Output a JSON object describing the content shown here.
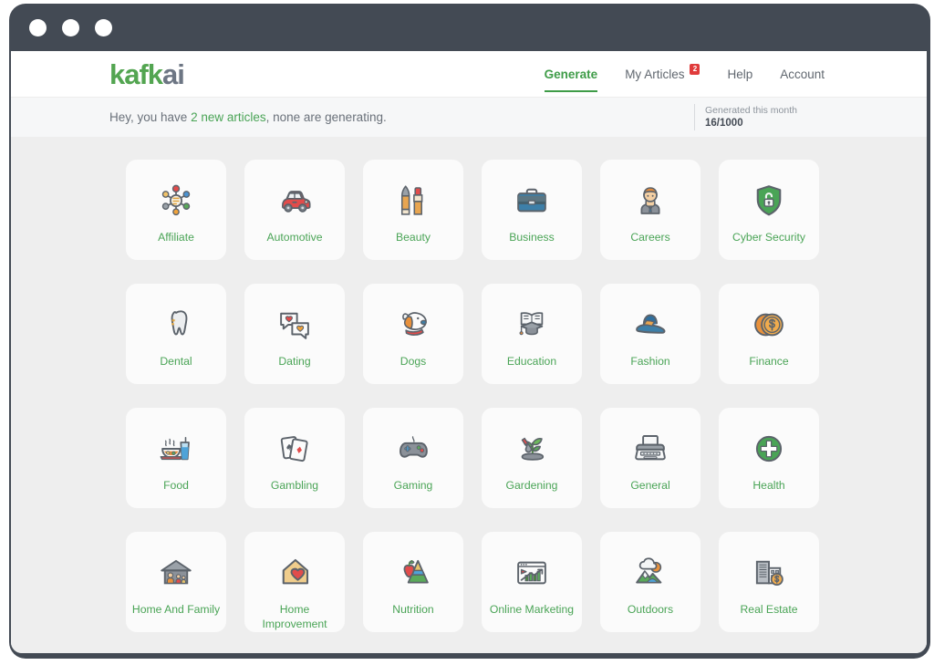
{
  "window": {
    "traffic_lights": [
      "close-dot",
      "minimize-dot",
      "maximize-dot"
    ]
  },
  "header": {
    "logo_green": "kafk",
    "logo_gray": "ai",
    "nav": [
      {
        "label": "Generate",
        "active": true,
        "badge": null,
        "name": "nav-generate"
      },
      {
        "label": "My Articles",
        "active": false,
        "badge": "2",
        "name": "nav-my-articles"
      },
      {
        "label": "Help",
        "active": false,
        "badge": null,
        "name": "nav-help"
      },
      {
        "label": "Account",
        "active": false,
        "badge": null,
        "name": "nav-account"
      }
    ]
  },
  "notice": {
    "prefix": "Hey, you have ",
    "highlight": "2 new articles",
    "suffix": ", none are generating.",
    "quota_label": "Generated this month",
    "quota_value": "16/1000"
  },
  "colors": {
    "brand_green": "#4aa456",
    "active_green": "#3f9c48",
    "badge_red": "#e03b3b",
    "chrome_dark": "#434A54",
    "page_bg": "#eeeeee",
    "card_bg": "#fbfbfb"
  },
  "categories": [
    {
      "label": "Affiliate",
      "icon": "affiliate-network-icon"
    },
    {
      "label": "Automotive",
      "icon": "car-icon"
    },
    {
      "label": "Beauty",
      "icon": "makeup-brush-lipstick-icon"
    },
    {
      "label": "Business",
      "icon": "briefcase-icon"
    },
    {
      "label": "Careers",
      "icon": "businessman-icon"
    },
    {
      "label": "Cyber Security",
      "icon": "shield-lock-icon"
    },
    {
      "label": "Dental",
      "icon": "tooth-icon"
    },
    {
      "label": "Dating",
      "icon": "chat-hearts-icon"
    },
    {
      "label": "Dogs",
      "icon": "dog-head-icon"
    },
    {
      "label": "Education",
      "icon": "book-graduation-cap-icon"
    },
    {
      "label": "Fashion",
      "icon": "sun-hat-icon"
    },
    {
      "label": "Finance",
      "icon": "dollar-coins-icon"
    },
    {
      "label": "Food",
      "icon": "noodle-bowl-drink-icon"
    },
    {
      "label": "Gambling",
      "icon": "playing-cards-icon"
    },
    {
      "label": "Gaming",
      "icon": "gamepad-icon"
    },
    {
      "label": "Gardening",
      "icon": "seedling-trowel-icon"
    },
    {
      "label": "General",
      "icon": "typewriter-icon"
    },
    {
      "label": "Health",
      "icon": "medical-cross-icon"
    },
    {
      "label": "Home And Family",
      "icon": "house-family-icon"
    },
    {
      "label": "Home Improvement",
      "icon": "house-heart-icon"
    },
    {
      "label": "Nutrition",
      "icon": "apple-food-pyramid-icon"
    },
    {
      "label": "Online Marketing",
      "icon": "browser-growth-chart-icon"
    },
    {
      "label": "Outdoors",
      "icon": "mountain-cloud-icon"
    },
    {
      "label": "Real Estate",
      "icon": "building-dollar-icon"
    }
  ]
}
